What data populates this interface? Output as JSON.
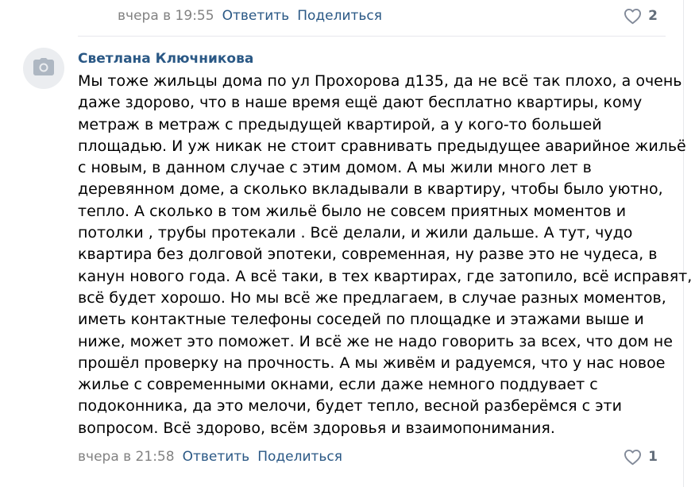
{
  "previous_comment": {
    "time": "вчера в 19:55",
    "reply_label": "Ответить",
    "share_label": "Поделиться",
    "likes": "2"
  },
  "comment": {
    "author": "Светлана Ключникова",
    "text_lines": [
      "Мы тоже жильцы дома по ул Прохорова д135, да не всё так плохо, а очень",
      "даже здорово, что в наше время ещё дают бесплатно квартиры, кому",
      "метраж в метраж с предыдущей квартирой, а у кого-то большей",
      "площадью. И уж никак не стоит сравнивать предыдущее аварийное жильё",
      "с новым, в данном случае с этим домом. А мы жили много лет в",
      "деревянном доме, а сколько вкладывали в квартиру, чтобы было уютно,",
      "тепло. А сколько в том жильё было не совсем приятных моментов и",
      "потолки , трубы протекали . Всё делали, и жили дальше. А тут, чудо",
      "квартира без долговой эпотеки, современная, ну разве это не чудеса, в",
      "канун нового года. А всё таки, в тех квартирах, где затопило, всё исправят,",
      "всё будет хорошо. Но мы всё же предлагаем, в случае разных моментов,",
      "иметь контактные телефоны соседей по площадке и этажами выше и",
      "ниже, может это поможет. И всё же не надо говорить за всех, что дом не",
      "прошёл проверку на прочность. А мы живём и радуемся, что у нас новое",
      "жилье с современными окнами, если даже немного поддувает с",
      "подоконника, да это мелочи, будет тепло, весной разберёмся с эти",
      "вопросом. Всё здорово, всём здоровья и взаимопонимания."
    ],
    "time": "вчера в 21:58",
    "reply_label": "Ответить",
    "share_label": "Поделиться",
    "likes": "1"
  },
  "icons": {
    "avatar_placeholder": "camera-icon",
    "like": "heart-icon"
  },
  "colors": {
    "link": "#2a5885",
    "meta": "#828282",
    "like_icon": "#828a99",
    "divider": "#e7e8ec",
    "avatar_bg": "#ebedf0",
    "avatar_icon": "#aeb7c2"
  }
}
